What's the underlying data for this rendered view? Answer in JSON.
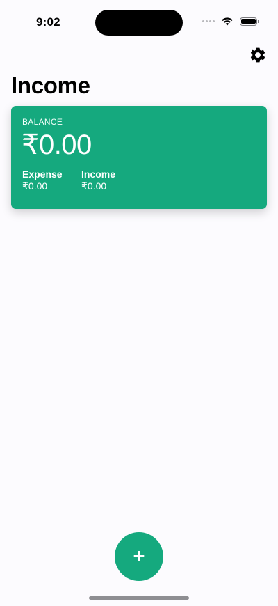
{
  "status_bar": {
    "time": "9:02"
  },
  "header": {
    "title": "Income",
    "settings_icon": "gear-icon"
  },
  "balance_card": {
    "balance_label": "BALANCE",
    "balance_amount": "₹0.00",
    "expense_label": "Expense",
    "expense_amount": "₹0.00",
    "income_label": "Income",
    "income_amount": "₹0.00"
  },
  "fab": {
    "label": "+",
    "icon": "plus-icon"
  },
  "colors": {
    "accent": "#15a97e",
    "background": "#fcfbfe"
  }
}
